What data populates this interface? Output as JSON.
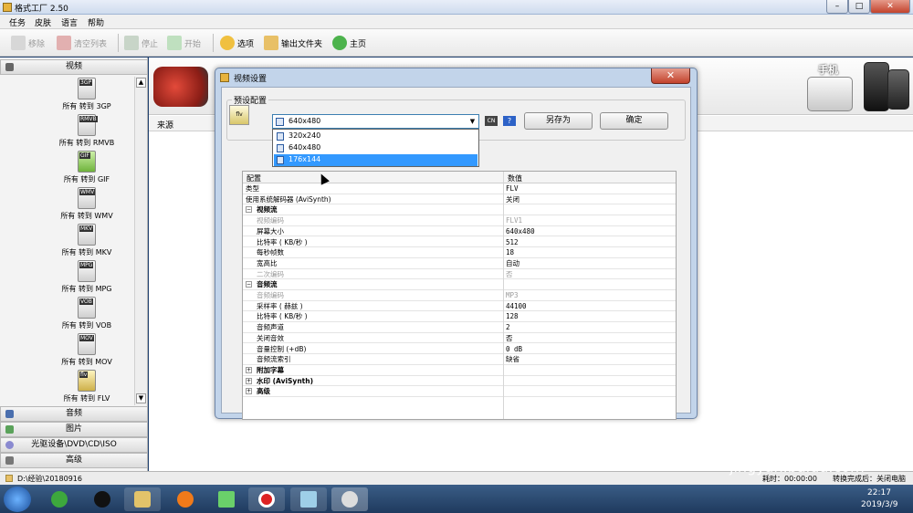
{
  "app": {
    "title": "格式工厂 2.50"
  },
  "menu": [
    "任务",
    "皮肤",
    "语言",
    "帮助"
  ],
  "toolbar": {
    "remove": "移除",
    "clear_list": "清空列表",
    "stop": "停止",
    "start": "开始",
    "options": "选项",
    "output_folder": "输出文件夹",
    "home": "主页"
  },
  "sidebar": {
    "video_header": "视频",
    "formats": [
      {
        "icon": "3GP",
        "label": "所有 转到 3GP"
      },
      {
        "icon": "RMVB",
        "label": "所有 转到 RMVB"
      },
      {
        "icon": "GIF",
        "label": "所有 转到 GIF"
      },
      {
        "icon": "WMV",
        "label": "所有 转到 WMV"
      },
      {
        "icon": "MKV",
        "label": "所有 转到 MKV"
      },
      {
        "icon": "MPG",
        "label": "所有 转到 MPG"
      },
      {
        "icon": "VOB",
        "label": "所有 转到 VOB"
      },
      {
        "icon": "MOV",
        "label": "所有 转到 MOV"
      },
      {
        "icon": "flv",
        "label": "所有 转到 FLV"
      }
    ],
    "categories": [
      "音频",
      "图片",
      "光驱设备\\DVD\\CD\\ISO",
      "高级"
    ]
  },
  "main": {
    "source_col": "来源",
    "phone_label": "手机"
  },
  "dialog": {
    "title": "视频设置",
    "preset_group": "预设配置",
    "combo_value": "640x480",
    "dropdown_items": [
      "320x240",
      "640x480",
      "176x144"
    ],
    "selected_index": 2,
    "save_as": "另存为",
    "ok": "确定",
    "grid_header": {
      "config": "配置",
      "value": "数值"
    },
    "rows": [
      {
        "k": "类型",
        "v": "FLV",
        "level": 0,
        "type": "item"
      },
      {
        "k": "使用系统解码器 (AviSynth)",
        "v": "关闭",
        "level": 0,
        "type": "item"
      },
      {
        "k": "视频流",
        "v": "",
        "level": 0,
        "type": "group",
        "exp": "⊟"
      },
      {
        "k": "视频编码",
        "v": "FLV1",
        "level": 1,
        "type": "disabled"
      },
      {
        "k": "屏幕大小",
        "v": "640x480",
        "level": 1,
        "type": "item"
      },
      {
        "k": "比特率 ( KB/秒 )",
        "v": "512",
        "level": 1,
        "type": "item"
      },
      {
        "k": "每秒帧数",
        "v": "18",
        "level": 1,
        "type": "item"
      },
      {
        "k": "宽高比",
        "v": "自动",
        "level": 1,
        "type": "item"
      },
      {
        "k": "二次编码",
        "v": "否",
        "level": 1,
        "type": "disabled"
      },
      {
        "k": "音频流",
        "v": "",
        "level": 0,
        "type": "group",
        "exp": "⊟"
      },
      {
        "k": "音频编码",
        "v": "MP3",
        "level": 1,
        "type": "disabled"
      },
      {
        "k": "采样率 ( 赫兹 )",
        "v": "44100",
        "level": 1,
        "type": "item"
      },
      {
        "k": "比特率 ( KB/秒 )",
        "v": "128",
        "level": 1,
        "type": "item"
      },
      {
        "k": "音频声道",
        "v": "2",
        "level": 1,
        "type": "item"
      },
      {
        "k": "关闭音效",
        "v": "否",
        "level": 1,
        "type": "item"
      },
      {
        "k": "音量控制 (+dB)",
        "v": "0 dB",
        "level": 1,
        "type": "item"
      },
      {
        "k": "音频流索引",
        "v": "缺省",
        "level": 1,
        "type": "item"
      },
      {
        "k": "附加字幕",
        "v": "",
        "level": 0,
        "type": "group",
        "exp": "⊞"
      },
      {
        "k": "水印 (AviSynth)",
        "v": "",
        "level": 0,
        "type": "group",
        "exp": "⊞"
      },
      {
        "k": "高级",
        "v": "",
        "level": 0,
        "type": "group",
        "exp": "⊞"
      }
    ]
  },
  "statusbar": {
    "path": "D:\\经验\\20180916",
    "elapsed": "耗时：00:00:00",
    "after": "转换完成后：关闭电脑"
  },
  "taskbar": {
    "time": "22:17",
    "date": "2019/3/9"
  },
  "watermark": {
    "brand": "Bai",
    "brand2": "du",
    "suffix": "经验",
    "url": "jingyan.baidu.com"
  },
  "colors": {
    "accent": "#3399ff",
    "dialog_frame": "#c2d4ea",
    "close": "#c3422c"
  }
}
